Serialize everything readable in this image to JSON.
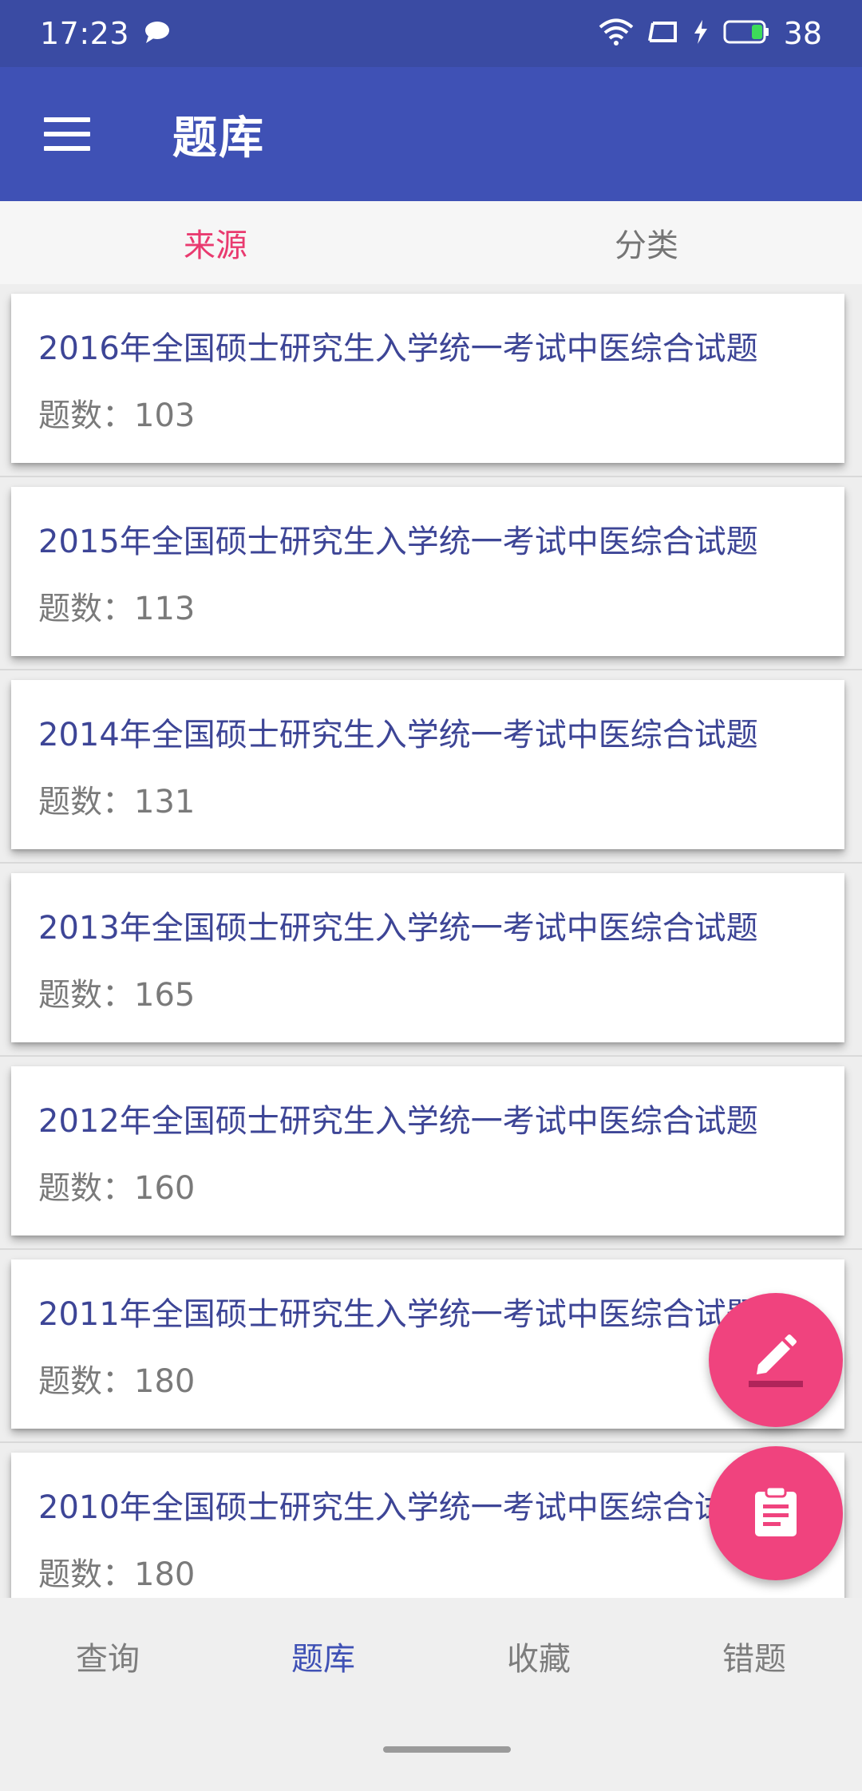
{
  "status_bar": {
    "time": "17:23",
    "battery": "38",
    "icons": [
      "chat-bubble-icon",
      "wifi-icon",
      "cast-icon",
      "charging-icon",
      "battery-icon"
    ]
  },
  "app_bar": {
    "title": "题库",
    "menu_icon": "menu-icon"
  },
  "tabs": [
    {
      "label": "来源",
      "active": true
    },
    {
      "label": "分类",
      "active": false
    }
  ],
  "list": {
    "items": [
      {
        "title": "2016年全国硕士研究生入学统一考试中医综合试题",
        "count": "题数：103"
      },
      {
        "title": "2015年全国硕士研究生入学统一考试中医综合试题",
        "count": "题数：113"
      },
      {
        "title": "2014年全国硕士研究生入学统一考试中医综合试题",
        "count": "题数：131"
      },
      {
        "title": "2013年全国硕士研究生入学统一考试中医综合试题",
        "count": "题数：165"
      },
      {
        "title": "2012年全国硕士研究生入学统一考试中医综合试题",
        "count": "题数：160"
      },
      {
        "title": "2011年全国硕士研究生入学统一考试中医综合试题",
        "count": "题数：180"
      },
      {
        "title": "2010年全国硕士研究生入学统一考试中医综合试题",
        "count": "题数：180"
      }
    ]
  },
  "fabs": [
    {
      "icon": "edit-icon"
    },
    {
      "icon": "clipboard-icon"
    }
  ],
  "bottom_nav": {
    "items": [
      {
        "label": "查询",
        "active": false
      },
      {
        "label": "题库",
        "active": true
      },
      {
        "label": "收藏",
        "active": false
      },
      {
        "label": "错题",
        "active": false
      }
    ]
  },
  "colors": {
    "status_bar": "#3a4ba3",
    "app_bar": "#3f51b5",
    "accent": "#f0437e",
    "active_tab": "#e93a6f",
    "card_title": "#3d4596"
  }
}
